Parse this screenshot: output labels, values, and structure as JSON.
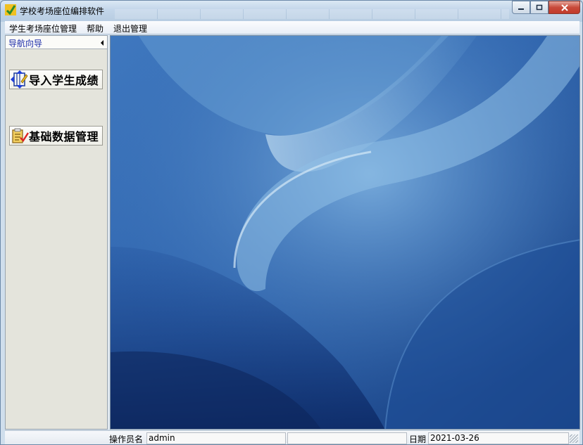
{
  "window": {
    "title": "学校考场座位编排软件"
  },
  "menu": {
    "items": [
      "学生考场座位管理",
      "帮助",
      "退出管理"
    ]
  },
  "nav": {
    "title": "导航向导",
    "buttons": [
      {
        "label": "导入学生成绩",
        "icon": "import-grades-icon"
      },
      {
        "label": "基础数据管理",
        "icon": "data-management-icon"
      }
    ]
  },
  "status": {
    "operator_label": "操作员名",
    "operator_value": "admin",
    "middle_value": "",
    "date_label": "日期",
    "date_value": "2021-03-26"
  },
  "colors": {
    "nav_title": "#1a2aa8",
    "wallpaper_base": "#2a5ba2",
    "close_button": "#c84a3a"
  }
}
